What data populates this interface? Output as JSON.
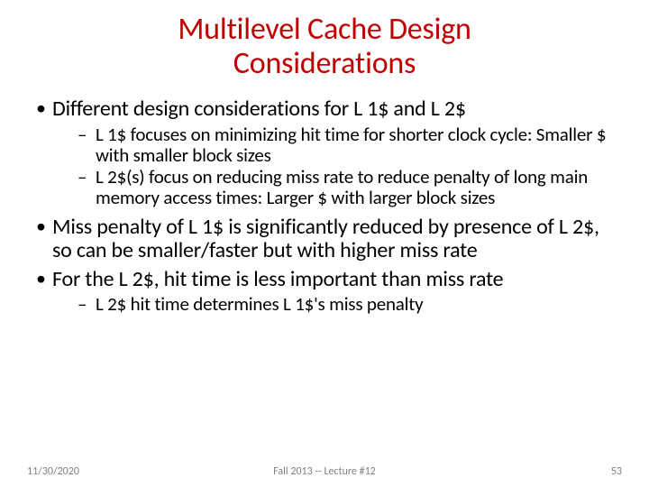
{
  "title_line1": "Multilevel Cache Design",
  "title_line2": "Considerations",
  "bullets": {
    "b1": "Different design considerations for L 1$ and L 2$",
    "b1_s1": "L 1$ focuses on minimizing hit time for shorter clock cycle: Smaller $ with smaller block sizes",
    "b1_s2": "L 2$(s) focus on reducing miss rate to reduce penalty of long main memory access times: Larger $ with larger block sizes",
    "b2": "Miss penalty of L 1$ is significantly reduced by presence of L 2$, so can be smaller/faster but with higher miss rate",
    "b3": "For the L 2$, hit time is less important than miss rate",
    "b3_s1": "L 2$ hit time determines L 1$'s miss penalty"
  },
  "footer": {
    "date": "11/30/2020",
    "center": "Fall 2013 -- Lecture #12",
    "page": "53"
  }
}
